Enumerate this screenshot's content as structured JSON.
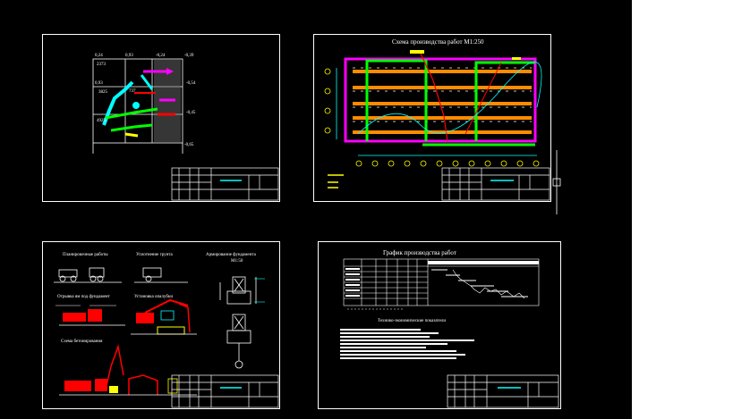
{
  "sheets": {
    "top_right_title": "Схема производства работ М1:250",
    "bottom_left": {
      "title1": "Планировочные работы",
      "title2": "Уплотнение грунта",
      "title3": "Армирование фундамента",
      "title3_scale": "М1:50",
      "title4": "Отрывка ям под фундамент",
      "title5": "Установка опалубки",
      "title6": "Схема бетонирования"
    },
    "bottom_right": {
      "title": "График производства работ",
      "subtitle": "Технико-экономические показатели"
    }
  },
  "sheet1_labels": {
    "l1": "0,24",
    "l2": "0,93",
    "l3": "-0,24",
    "l4": "-0,39",
    "l5": "2373",
    "l6": "0,93",
    "l7": "-0,54",
    "l8": "-0,45",
    "l9": "-0,65",
    "l10": "4925",
    "l11": "3825",
    "l12": "737"
  },
  "colors": {
    "red": "#ff0000",
    "green": "#00ff00",
    "magenta": "#ff00ff",
    "cyan": "#00ffff",
    "yellow": "#ffff00",
    "blue": "#3b6bff",
    "orange": "#ff8c00"
  }
}
